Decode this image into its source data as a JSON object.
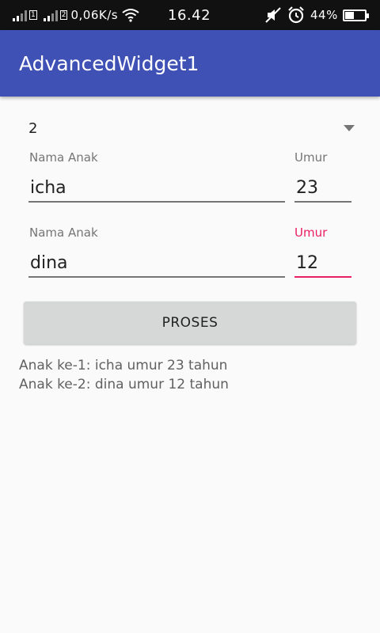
{
  "status_bar": {
    "network_speed": "0,06K/s",
    "time": "16.42",
    "battery_percent": "44%",
    "battery_level": 0.44,
    "icons": [
      "signal-icon",
      "sim-1-icon",
      "signal-icon",
      "sim-2-icon",
      "wifi-icon",
      "mute-icon",
      "alarm-icon",
      "battery-icon"
    ]
  },
  "app_bar": {
    "title": "AdvancedWidget1"
  },
  "spinner": {
    "value": "2"
  },
  "children": [
    {
      "name_label": "Nama Anak",
      "name_value": "icha",
      "age_label": "Umur",
      "age_value": "23"
    },
    {
      "name_label": "Nama Anak",
      "name_value": "dina",
      "age_label": "Umur",
      "age_value": "12"
    }
  ],
  "button": {
    "label": "PROSES"
  },
  "results": [
    "Anak ke-1: icha umur 23 tahun",
    "Anak ke-2: dina umur 12 tahun"
  ],
  "colors": {
    "primary": "#3f51b5",
    "accent": "#e91e63"
  }
}
